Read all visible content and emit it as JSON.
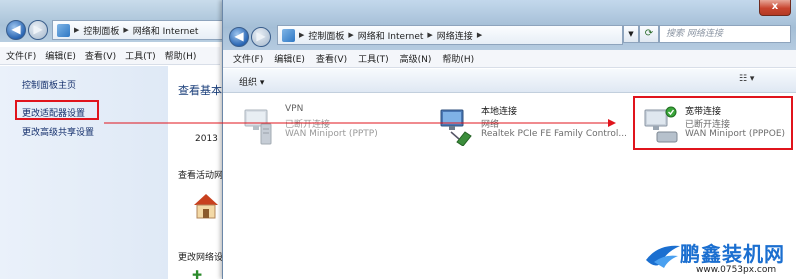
{
  "background_window": {
    "breadcrumb": [
      "控制面板",
      "网络和 Internet"
    ],
    "menu": [
      "文件(F)",
      "编辑(E)",
      "查看(V)",
      "工具(T)",
      "帮助(H)"
    ],
    "sidebar": [
      "控制面板主页",
      "更改适配器设置",
      "更改高级共享设置"
    ],
    "main": {
      "heading": "查看基本",
      "year": "2013",
      "activity": "查看活动网",
      "change": "更改网络设"
    }
  },
  "front_window": {
    "breadcrumb": [
      "控制面板",
      "网络和 Internet",
      "网络连接"
    ],
    "search_placeholder": "搜索 网络连接",
    "menu": [
      "文件(F)",
      "编辑(E)",
      "查看(V)",
      "工具(T)",
      "高级(N)",
      "帮助(H)"
    ],
    "toolbar": {
      "organize": "组织 ▾"
    },
    "connections": [
      {
        "name": "VPN",
        "status": "已断开连接",
        "device": "WAN Miniport (PPTP)"
      },
      {
        "name": "本地连接",
        "status": "网络",
        "device": "Realtek PCIe FE Family Control..."
      },
      {
        "name": "宽带连接",
        "status": "已断开连接",
        "device": "WAN Miniport (PPPOE)"
      }
    ]
  },
  "watermark": {
    "brand": "鹏鑫装机网",
    "url": "www.0753px.com"
  },
  "colors": {
    "highlight": "#e0141c",
    "link": "#142f6c",
    "brand": "#1b6fd0"
  }
}
